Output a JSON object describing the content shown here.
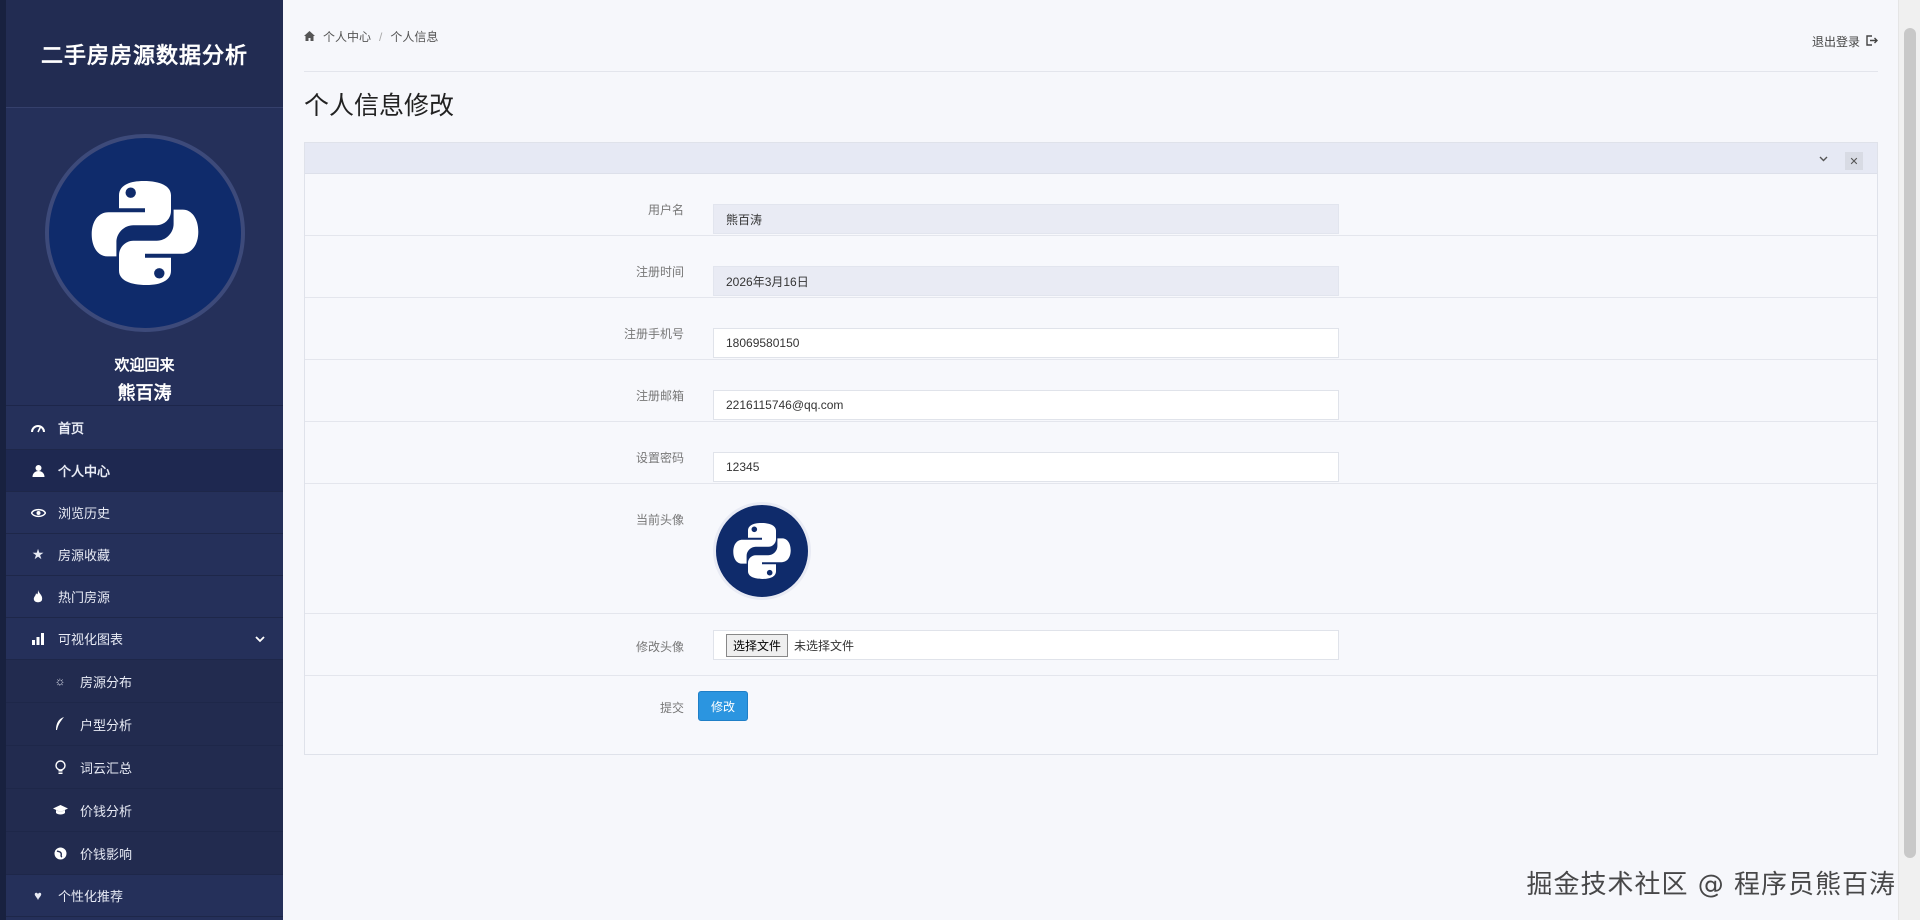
{
  "app": {
    "title": "二手房房源数据分析"
  },
  "profile": {
    "welcome": "欢迎回来",
    "name": "熊百涛"
  },
  "sidebar": {
    "items": [
      {
        "label": "首页",
        "icon": "dashboard-icon"
      },
      {
        "label": "个人中心",
        "icon": "user-icon"
      },
      {
        "label": "浏览历史",
        "icon": "eye-icon"
      },
      {
        "label": "房源收藏",
        "icon": "star-icon"
      },
      {
        "label": "热门房源",
        "icon": "fire-icon"
      },
      {
        "label": "可视化图表",
        "icon": "bar-chart-icon"
      },
      {
        "label": "房源分布",
        "icon": "sun-icon"
      },
      {
        "label": "户型分析",
        "icon": "feather-icon"
      },
      {
        "label": "词云汇总",
        "icon": "bulb-icon"
      },
      {
        "label": "价钱分析",
        "icon": "graduation-icon"
      },
      {
        "label": "价钱影响",
        "icon": "globe-icon"
      },
      {
        "label": "个性化推荐",
        "icon": "heart-icon"
      }
    ]
  },
  "breadcrumb": {
    "home": "个人中心",
    "current": "个人信息"
  },
  "header": {
    "logout": "退出登录"
  },
  "page": {
    "title": "个人信息修改"
  },
  "form": {
    "username_label": "用户名",
    "username_value": "熊百涛",
    "regtime_label": "注册时间",
    "regtime_value": "2026年3月16日",
    "phone_label": "注册手机号",
    "phone_value": "18069580150",
    "email_label": "注册邮箱",
    "email_value": "2216115746@qq.com",
    "password_label": "设置密码",
    "password_value": "12345",
    "avatar_label": "当前头像",
    "change_avatar_label": "修改头像",
    "file_button": "选择文件",
    "file_status": "未选择文件",
    "submit_label": "提交",
    "submit_button": "修改"
  },
  "watermark": "掘金技术社区 @ 程序员熊百涛",
  "colors": {
    "sidebar": "#25305a",
    "accent": "#2b95e0",
    "avatar_bg": "#0f2b6b"
  }
}
